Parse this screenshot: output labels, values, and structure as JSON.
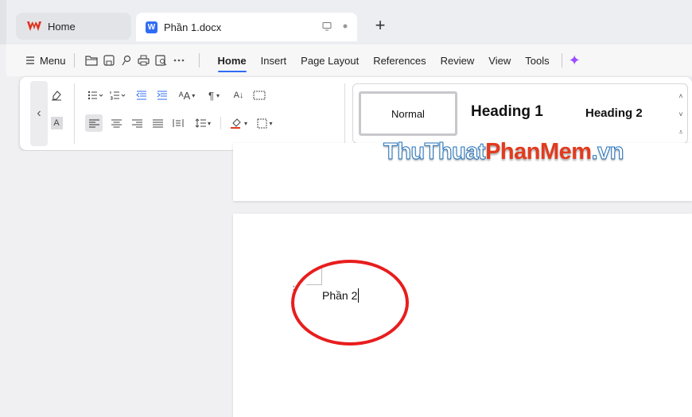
{
  "tabs": {
    "home_label": "Home",
    "doc_label": "Phần 1.docx",
    "doc_logo_letter": "W"
  },
  "menu": {
    "menu_label": "Menu",
    "ribbon_tabs": [
      "Home",
      "Insert",
      "Page Layout",
      "References",
      "Review",
      "View",
      "Tools"
    ],
    "active_tab": "Home"
  },
  "styles": {
    "normal": "Normal",
    "heading1": "Heading 1",
    "heading2": "Heading 2"
  },
  "document": {
    "text": "Phần 2"
  },
  "watermark": {
    "part1": "ThuThuat",
    "part2": "PhanMem",
    "part3": ".vn"
  },
  "colors": {
    "accent": "#2f6cf6",
    "annotation": "#e81d1d",
    "wps_red": "#e0301e"
  },
  "icons": [
    "wps-logo-icon",
    "writer-doc-icon",
    "monitor-icon",
    "dot-icon",
    "plus-icon",
    "menu-icon",
    "open-folder-icon",
    "save-icon",
    "export-icon",
    "print-icon",
    "print-preview-icon",
    "more-icon",
    "ai-sparkle-icon",
    "chevron-left-icon",
    "clear-format-icon",
    "char-shading-icon",
    "bullet-list-icon",
    "numbered-list-icon",
    "decrease-indent-icon",
    "increase-indent-icon",
    "font-size-icon",
    "paragraph-mark-icon",
    "sort-icon",
    "table-icon",
    "align-left-icon",
    "align-center-icon",
    "align-right-icon",
    "justify-icon",
    "distributed-icon",
    "line-spacing-icon",
    "shading-icon",
    "borders-icon"
  ]
}
